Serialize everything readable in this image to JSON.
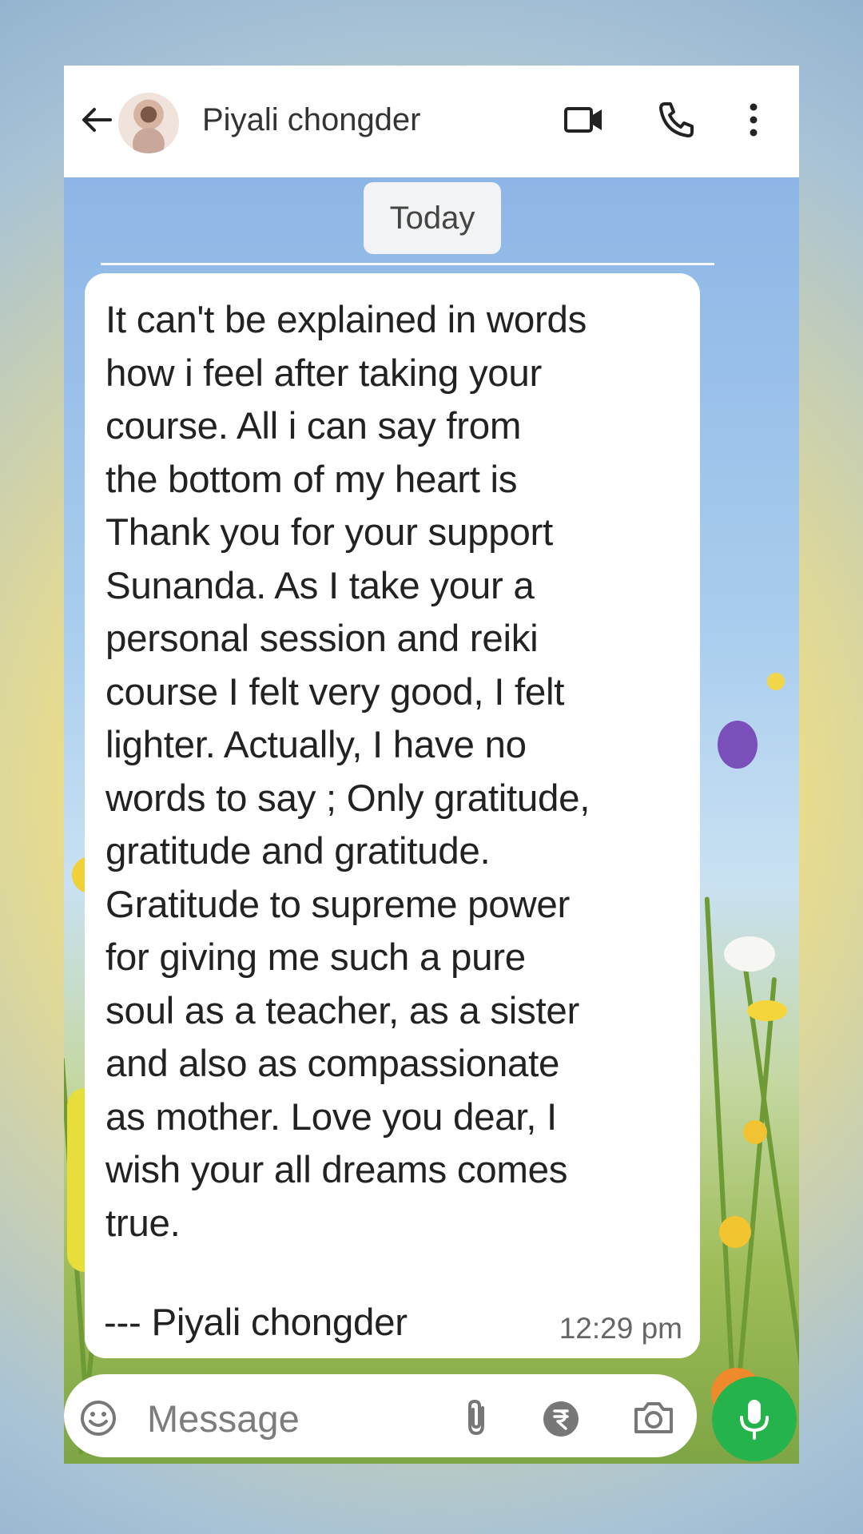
{
  "header": {
    "contact_name": "Piyali chongder",
    "icons": [
      "back-arrow-icon",
      "avatar",
      "video-call-icon",
      "phone-icon",
      "more-options-icon"
    ]
  },
  "date_chip": "Today",
  "message": {
    "text": "It can't be explained in words\nhow i feel after taking your\ncourse. All i can say from\nthe bottom of my heart is\nThank you for your support\nSunanda. As I take your a\npersonal session and reiki\ncourse I felt very good, I felt\nlighter. Actually, I have no\nwords to say ; Only gratitude,\ngratitude and gratitude.\nGratitude to supreme power\nfor giving me such a pure\nsoul as a teacher, as a sister\nand also as compassionate\nas mother. Love you dear, I\nwish your all dreams comes\ntrue.",
    "signature": "--- Piyali chongder",
    "time": "12:29 pm"
  },
  "input": {
    "placeholder": "Message",
    "icons": [
      "emoji-icon",
      "attach-icon",
      "rupee-payment-icon",
      "camera-icon",
      "mic-icon"
    ]
  },
  "colors": {
    "mic_button": "#25b34c",
    "bubble": "#ffffff",
    "header": "#ffffff"
  }
}
